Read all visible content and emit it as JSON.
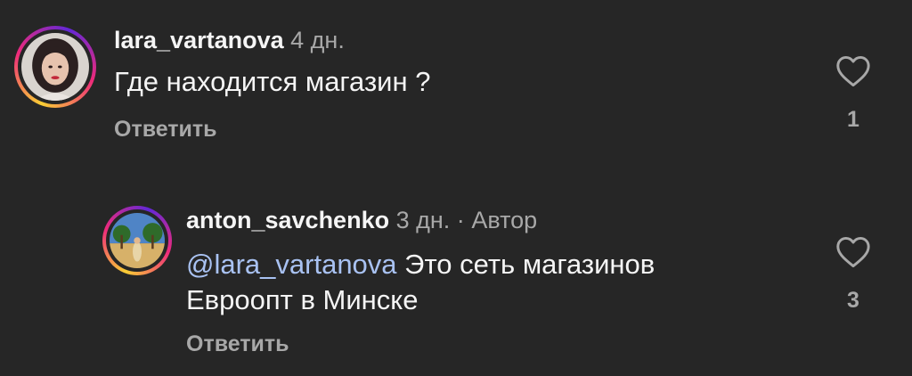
{
  "comments": [
    {
      "username": "lara_vartanova",
      "time": "4 дн.",
      "text": "Где находится магазин ?",
      "reply_label": "Ответить",
      "like_count": "1"
    },
    {
      "username": "anton_savchenko",
      "time": "3 дн.",
      "separator": "·",
      "author_badge": "Автор",
      "mention": "@lara_vartanova",
      "text_line1": " Это сеть магазинов",
      "text_line2": "Евроопт в Минске",
      "reply_label": "Ответить",
      "like_count": "3"
    }
  ],
  "colors": {
    "background": "#262626",
    "text": "#f5f5f5",
    "secondary": "#a8a8a8",
    "mention": "#a9c2f2"
  },
  "icons": {
    "like": "heart-outline-icon"
  }
}
